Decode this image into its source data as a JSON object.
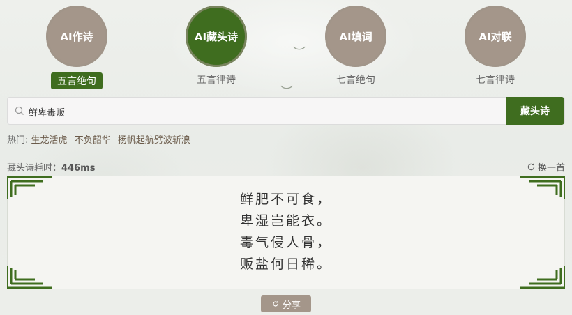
{
  "modes": [
    {
      "label": "AI作诗",
      "sub": "五言绝句"
    },
    {
      "label": "AI藏头诗",
      "sub": "五言律诗"
    },
    {
      "label": "AI填词",
      "sub": "七言绝句"
    },
    {
      "label": "AI对联",
      "sub": "七言律诗"
    }
  ],
  "search": {
    "value": "鲜卑毒贩",
    "button": "藏头诗"
  },
  "hot": {
    "label": "热门:",
    "items": [
      "生龙活虎",
      "不负韶华",
      "扬帆起航劈波斩浪"
    ]
  },
  "result": {
    "timing_label": "藏头诗耗时：",
    "timing_value": "446ms",
    "swap_label": "换一首",
    "lines": [
      "鲜肥不可食，",
      "卑湿岂能衣。",
      "毒气侵人骨，",
      "贩盐何日稀。"
    ]
  },
  "share_label": "分享",
  "colors": {
    "accent": "#3f6d1f",
    "taupe": "#a4968a"
  }
}
